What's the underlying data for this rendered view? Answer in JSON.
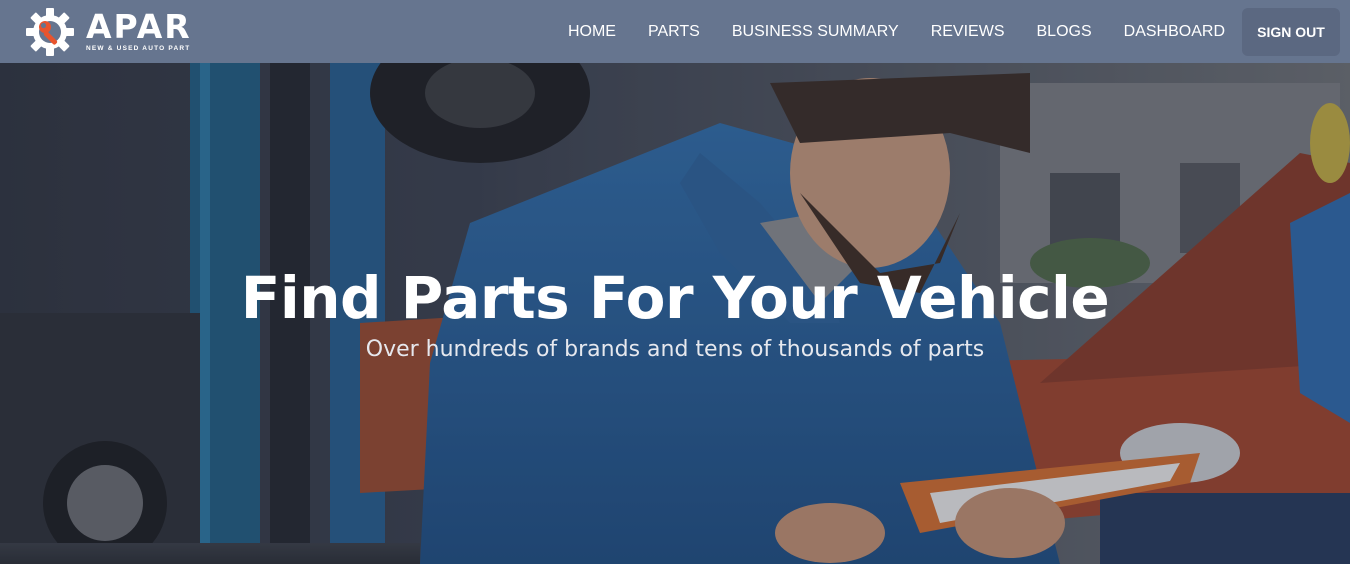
{
  "brand": {
    "name": "APAR",
    "tagline": "New & Used Auto Part",
    "logo_icon": "gear-wrench-icon",
    "accent_color": "#e8542e"
  },
  "nav": {
    "links": [
      {
        "label": "HOME"
      },
      {
        "label": "PARTS"
      },
      {
        "label": "BUSINESS SUMMARY"
      },
      {
        "label": "REVIEWS"
      },
      {
        "label": "BLOGS"
      },
      {
        "label": "DASHBOARD"
      }
    ],
    "signout_label": "SIGN OUT",
    "bar_color": "#66758f"
  },
  "hero": {
    "title": "Find Parts For Your Vehicle",
    "subtitle": "Over hundreds of brands and tens of thousands of parts"
  }
}
